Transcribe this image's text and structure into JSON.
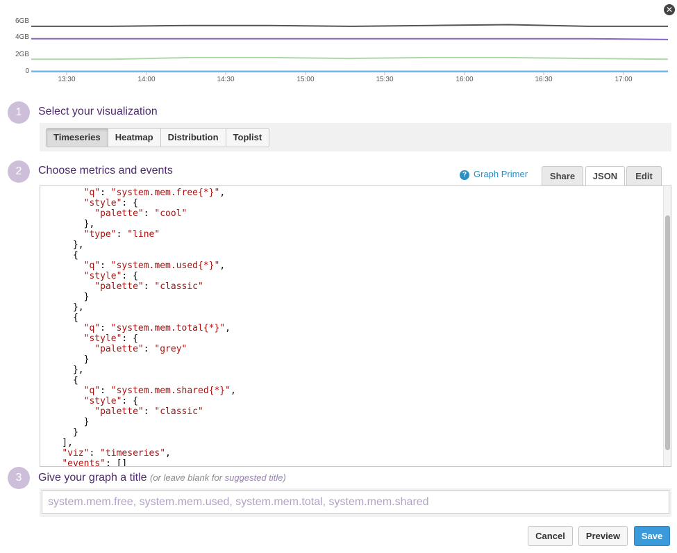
{
  "close_label": "✕",
  "chart_data": {
    "type": "line",
    "x_ticks": [
      "13:30",
      "14:00",
      "14:30",
      "15:00",
      "15:30",
      "16:00",
      "16:30",
      "17:00"
    ],
    "y_ticks": [
      "6GB",
      "4GB",
      "2GB",
      "0"
    ],
    "ylim": [
      0,
      6
    ],
    "y_unit": "GB",
    "grid": false,
    "series": [
      {
        "name": "",
        "color": "#555555",
        "values": [
          5.5,
          5.5,
          5.6,
          5.6,
          5.5,
          5.6,
          5.7,
          5.5,
          5.5
        ]
      },
      {
        "name": "",
        "color": "#8b63c4",
        "values": [
          4.0,
          4.0,
          4.0,
          4.0,
          4.0,
          4.0,
          4.0,
          4.0,
          3.9
        ]
      },
      {
        "name": "",
        "color": "#a8dca3",
        "values": [
          1.5,
          1.5,
          1.7,
          1.7,
          1.6,
          1.7,
          1.7,
          1.6,
          1.5
        ]
      },
      {
        "name": "",
        "color": "#4a9fd6",
        "values": [
          0.05,
          0.05,
          0.05,
          0.05,
          0.05,
          0.05,
          0.05,
          0.05,
          0.05
        ]
      }
    ]
  },
  "steps": {
    "one": {
      "num": "1",
      "title": "Select your visualization"
    },
    "two": {
      "num": "2",
      "title": "Choose metrics and events"
    },
    "three": {
      "num": "3",
      "title": "Give your graph a title",
      "hint_pre": "(or leave blank for ",
      "hint_link": "suggested title",
      "hint_post": ")"
    }
  },
  "viz_buttons": [
    "Timeseries",
    "Heatmap",
    "Distribution",
    "Toplist"
  ],
  "viz_active": "Timeseries",
  "graph_primer": "Graph Primer",
  "tabs": {
    "share": "Share",
    "json": "JSON",
    "edit": "Edit"
  },
  "json_lines": [
    "        \"q\": \"system.mem.free{*}\",",
    "        \"style\": {",
    "          \"palette\": \"cool\"",
    "        },",
    "        \"type\": \"line\"",
    "      },",
    "      {",
    "        \"q\": \"system.mem.used{*}\",",
    "        \"style\": {",
    "          \"palette\": \"classic\"",
    "        }",
    "      },",
    "      {",
    "        \"q\": \"system.mem.total{*}\",",
    "        \"style\": {",
    "          \"palette\": \"grey\"",
    "        }",
    "      },",
    "      {",
    "        \"q\": \"system.mem.shared{*}\",",
    "        \"style\": {",
    "          \"palette\": \"classic\"",
    "        }",
    "      }",
    "    ],",
    "    \"viz\": \"timeseries\",",
    "    \"events\": []"
  ],
  "title_input": {
    "value": "",
    "placeholder": "system.mem.free, system.mem.used, system.mem.total, system.mem.shared"
  },
  "footer": {
    "cancel": "Cancel",
    "preview": "Preview",
    "save": "Save"
  }
}
